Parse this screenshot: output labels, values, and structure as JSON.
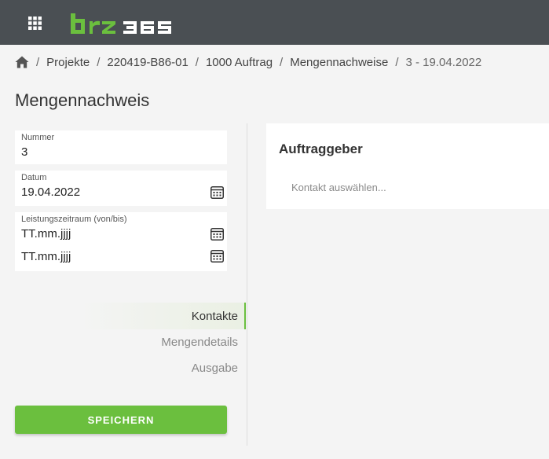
{
  "header": {
    "logo_text": "brz 365",
    "icons": {
      "apps": "grid-apps-icon",
      "logo": "brz-logo"
    },
    "colors": {
      "bar": "#4a4f53",
      "logo_green": "#6bbf3e"
    }
  },
  "breadcrumb": {
    "home_icon": "home-icon",
    "items": [
      "Projekte",
      "220419-B86-01",
      "1000 Auftrag",
      "Mengennachweise",
      "3 - 19.04.2022"
    ],
    "separator": "/"
  },
  "page_title": "Mengennachweis",
  "fields": {
    "nummer": {
      "label": "Nummer",
      "value": "3"
    },
    "datum": {
      "label": "Datum",
      "value": "19.04.2022"
    },
    "leistungszeitraum": {
      "label": "Leistungszeitraum (von/bis)",
      "from": "TT.mm.jjjj",
      "to": "TT.mm.jjjj"
    }
  },
  "side_nav": {
    "items": [
      "Kontakte",
      "Mengendetails",
      "Ausgabe"
    ],
    "active": "Kontakte"
  },
  "save_button": {
    "label": "SPEICHERN",
    "color": "#6bbf3e"
  },
  "panel": {
    "title": "Auftraggeber",
    "contact_placeholder": "Kontakt auswählen..."
  }
}
